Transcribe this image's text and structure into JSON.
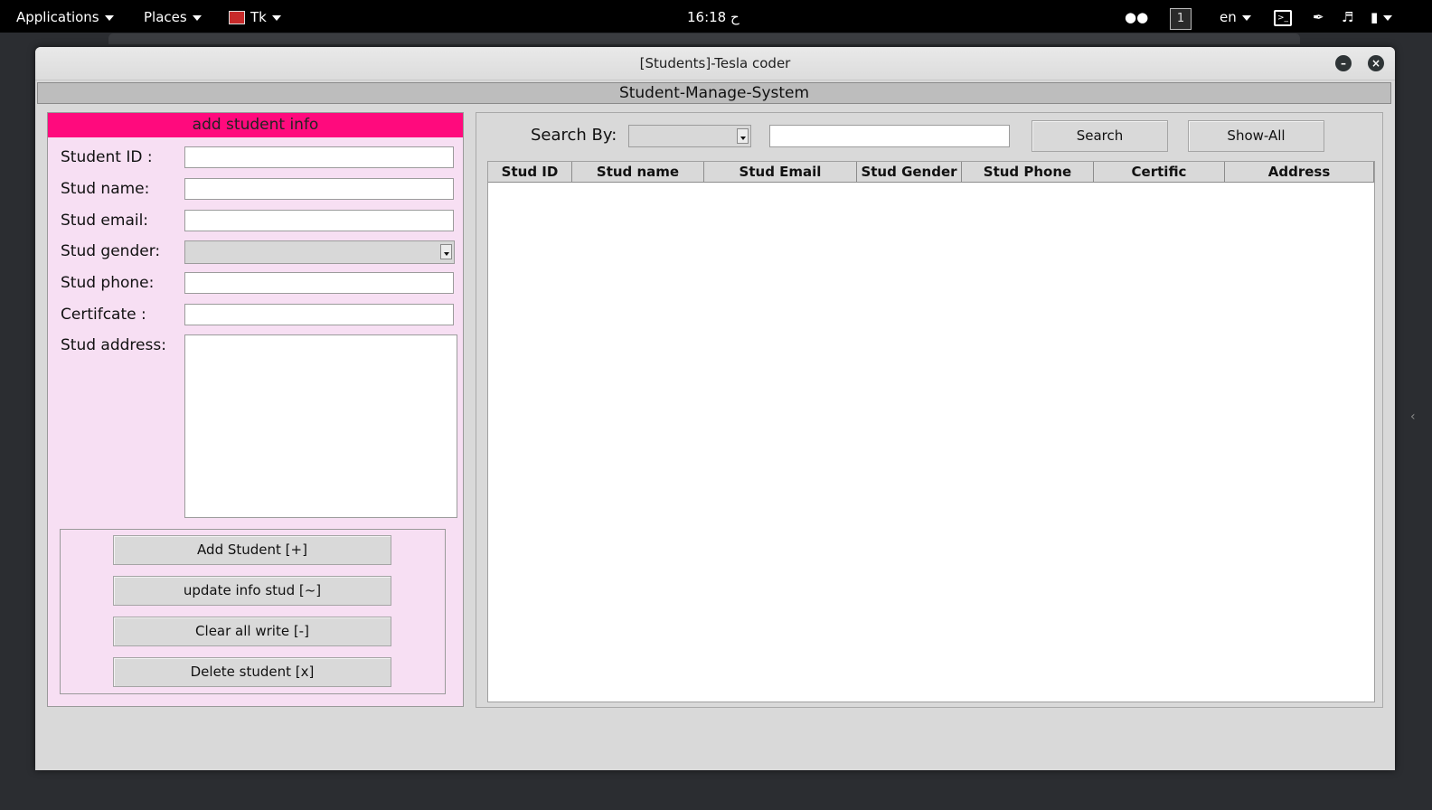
{
  "topbar": {
    "applications": "Applications",
    "places": "Places",
    "tk": "Tk",
    "clock": "16:18 ح",
    "workspace": "1",
    "language": "en"
  },
  "window": {
    "title": "[Students]-Tesla coder",
    "header": "Student-Manage-System"
  },
  "form": {
    "title": "add student info",
    "labels": {
      "id": "Student ID :",
      "name": "Stud name:",
      "email": "Stud email:",
      "gender": "Stud gender:",
      "phone": "Stud phone:",
      "certificate": "Certifcate :",
      "address": "Stud address:"
    },
    "buttons": {
      "add": "Add Student  [+]",
      "update": "update info stud [~]",
      "clear": "Clear all write  [-]",
      "delete": "Delete student  [x]"
    }
  },
  "search": {
    "label": "Search By:",
    "search_button": "Search",
    "show_all_button": "Show-All"
  },
  "table": {
    "columns": [
      "Stud ID",
      "Stud name",
      "Stud Email",
      "Stud Gender",
      "Stud Phone",
      "Certific",
      "Address"
    ],
    "rows": []
  },
  "colors": {
    "form_header": "#ff0a7d",
    "form_background": "#f7dff3",
    "window_background": "#d9d9d9"
  },
  "icons": [
    "app-menu-caret-icon",
    "tk-app-icon",
    "screen-share-icon",
    "terminal-icon",
    "pen-icon",
    "volume-icon",
    "battery-icon",
    "minimize-icon",
    "close-icon"
  ]
}
